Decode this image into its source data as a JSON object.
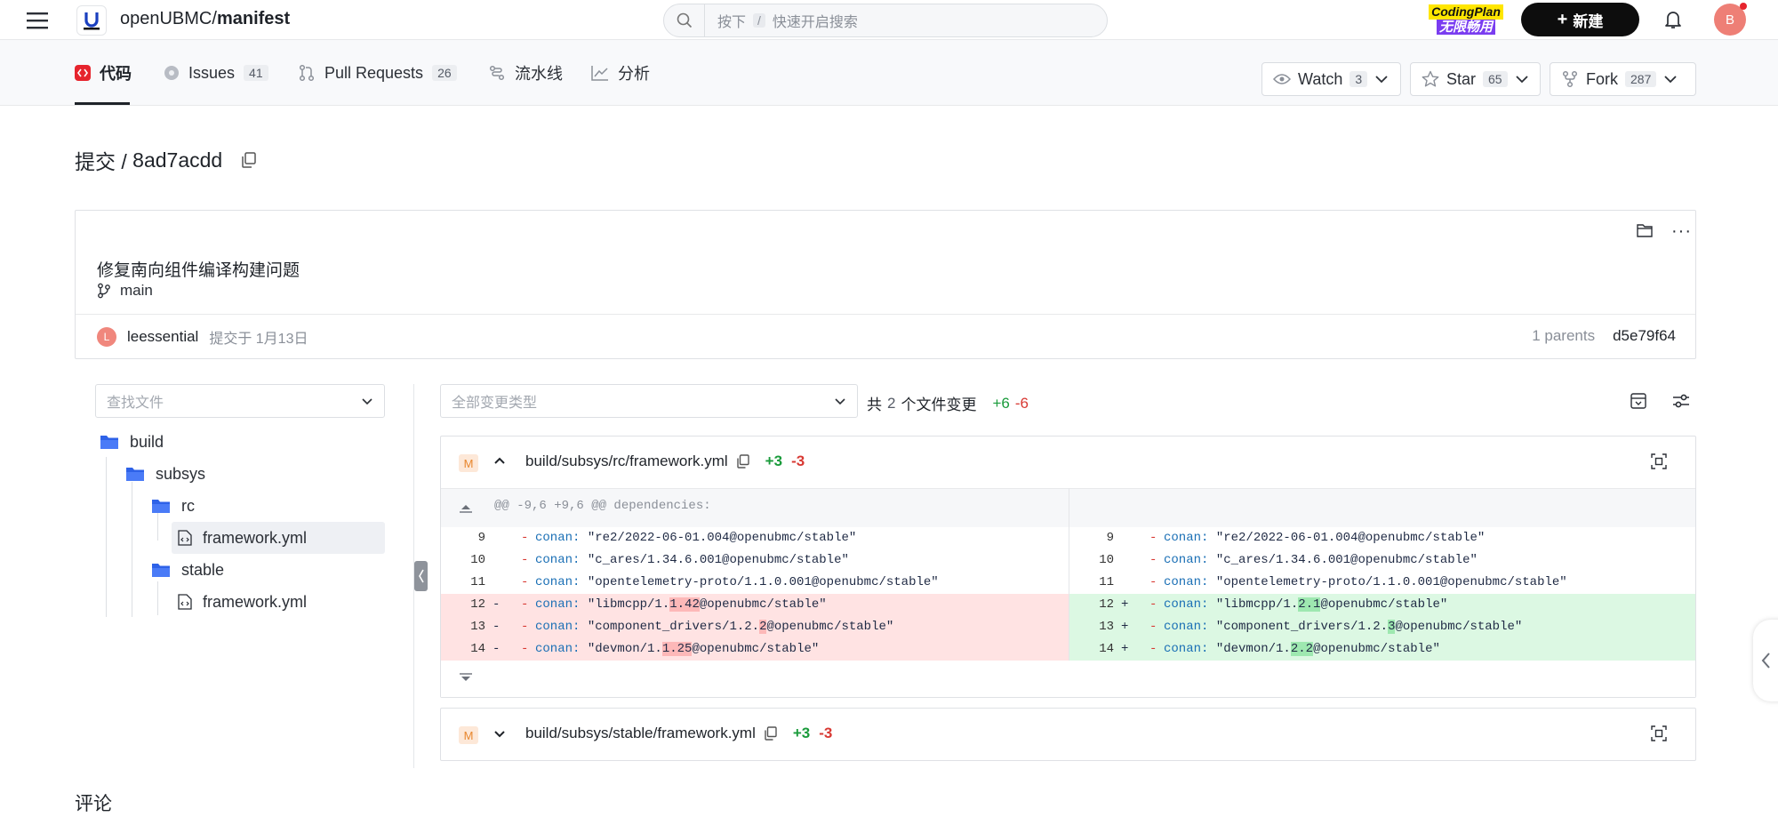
{
  "header": {
    "org": "openUBMC",
    "sep": "/",
    "repo": "manifest",
    "search_shortcut_prefix": "按下",
    "search_shortcut_key": "/",
    "search_placeholder": "快速开启搜索",
    "promo_line1": "CodingPlan",
    "promo_line2": "无限畅用",
    "new_button": "新建",
    "avatar_letter": "B"
  },
  "tabs": [
    {
      "label": "代码",
      "count": ""
    },
    {
      "label": "Issues",
      "count": "41"
    },
    {
      "label": "Pull Requests",
      "count": "26"
    },
    {
      "label": "流水线",
      "count": ""
    },
    {
      "label": "分析",
      "count": ""
    }
  ],
  "social": {
    "watch_label": "Watch",
    "watch_count": "3",
    "star_label": "Star",
    "star_count": "65",
    "fork_label": "Fork",
    "fork_count": "287"
  },
  "commit": {
    "title_prefix": "提交 / ",
    "hash": "8ad7acdd",
    "message": "修复南向组件编译构建问题",
    "branch": "main",
    "author_initial": "L",
    "author": "leessential",
    "committed": "提交于 1月13日",
    "parents_label": "1 parents",
    "parent_hash": "d5e79f64"
  },
  "filters": {
    "file_search_placeholder": "查找文件",
    "change_type_placeholder": "全部变更类型",
    "summary_prefix": "共",
    "file_count": "2",
    "summary_suffix": "个文件变更",
    "additions": "+6",
    "deletions": "-6"
  },
  "tree": [
    {
      "name": "build",
      "type": "folder"
    },
    {
      "name": "subsys",
      "type": "folder"
    },
    {
      "name": "rc",
      "type": "folder"
    },
    {
      "name": "framework.yml",
      "type": "file"
    },
    {
      "name": "stable",
      "type": "folder"
    },
    {
      "name": "framework.yml",
      "type": "file"
    }
  ],
  "diff_files": [
    {
      "badge": "M",
      "path": "build/subsys/rc/framework.yml",
      "additions": "+3",
      "deletions": "-3"
    },
    {
      "badge": "M",
      "path": "build/subsys/stable/framework.yml",
      "additions": "+3",
      "deletions": "-3"
    }
  ],
  "hunk_header": "@@ -9,6 +9,6 @@ dependencies:",
  "left_lines": [
    {
      "num": "9",
      "sign": "",
      "key": "conan:",
      "pre": " \"re2/2022-06-01.004@openubmc/stable\"",
      "hl": "",
      "post": ""
    },
    {
      "num": "10",
      "sign": "",
      "key": "conan:",
      "pre": " \"c_ares/1.34.6.001@openubmc/stable\"",
      "hl": "",
      "post": ""
    },
    {
      "num": "11",
      "sign": "",
      "key": "conan:",
      "pre": " \"opentelemetry-proto/1.1.0.001@openubmc/stable\"",
      "hl": "",
      "post": ""
    },
    {
      "num": "12",
      "sign": "-",
      "key": "conan:",
      "pre": " \"libmcpp/1.",
      "hl": "1.42",
      "post": "@openubmc/stable\""
    },
    {
      "num": "13",
      "sign": "-",
      "key": "conan:",
      "pre": " \"component_drivers/1.2.",
      "hl": "2",
      "post": "@openubmc/stable\""
    },
    {
      "num": "14",
      "sign": "-",
      "key": "conan:",
      "pre": " \"devmon/1.",
      "hl": "1.25",
      "post": "@openubmc/stable\""
    }
  ],
  "right_lines": [
    {
      "num": "9",
      "sign": "",
      "key": "conan:",
      "pre": " \"re2/2022-06-01.004@openubmc/stable\"",
      "hl": "",
      "post": ""
    },
    {
      "num": "10",
      "sign": "",
      "key": "conan:",
      "pre": " \"c_ares/1.34.6.001@openubmc/stable\"",
      "hl": "",
      "post": ""
    },
    {
      "num": "11",
      "sign": "",
      "key": "conan:",
      "pre": " \"opentelemetry-proto/1.1.0.001@openubmc/stable\"",
      "hl": "",
      "post": ""
    },
    {
      "num": "12",
      "sign": "+",
      "key": "conan:",
      "pre": " \"libmcpp/1.",
      "hl": "2.1",
      "post": "@openubmc/stable\""
    },
    {
      "num": "13",
      "sign": "+",
      "key": "conan:",
      "pre": " \"component_drivers/1.2.",
      "hl": "3",
      "post": "@openubmc/stable\""
    },
    {
      "num": "14",
      "sign": "+",
      "key": "conan:",
      "pre": " \"devmon/1.",
      "hl": "2.2",
      "post": "@openubmc/stable\""
    }
  ],
  "comments_heading": "评论",
  "colors": {
    "accent": "#e6242d",
    "add": "#1a9b3b",
    "del": "#d83933",
    "del_bg": "#ffe3e3",
    "add_bg": "#dcf8e3"
  }
}
